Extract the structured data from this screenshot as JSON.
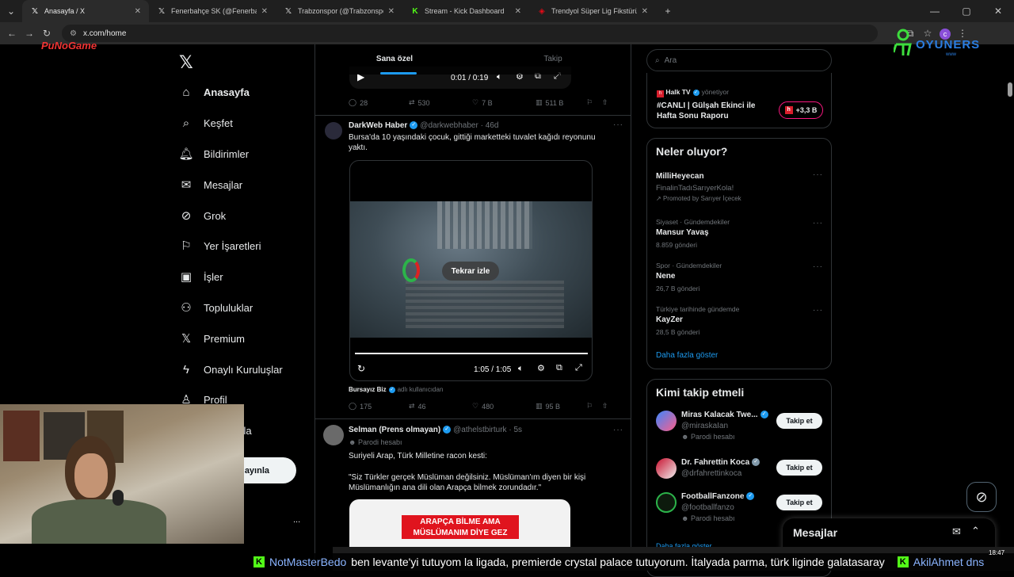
{
  "browser": {
    "tabs": [
      {
        "title": "Anasayfa / X",
        "icon": "x-logo-icon",
        "active": true
      },
      {
        "title": "Fenerbahçe SK (@Fenerbahce) ",
        "icon": "x-logo-icon"
      },
      {
        "title": "Trabzonspor (@Trabzonspor) / ",
        "icon": "x-logo-icon"
      },
      {
        "title": "Stream - Kick Dashboard",
        "icon": "kick-icon"
      },
      {
        "title": "Trendyol Süper Lig Fikstürü ve ",
        "icon": "tff-icon"
      }
    ],
    "address": "x.com/home"
  },
  "overlay": {
    "corner_logo": "PuNoGame",
    "brand_logo": "OYUNERS",
    "brand_sub": "www"
  },
  "nav": {
    "items": [
      {
        "label": "Anasayfa",
        "icon": "home-icon"
      },
      {
        "label": "Keşfet",
        "icon": "search-icon"
      },
      {
        "label": "Bildirimler",
        "icon": "bell-icon"
      },
      {
        "label": "Mesajlar",
        "icon": "mail-icon"
      },
      {
        "label": "Grok",
        "icon": "grok-icon"
      },
      {
        "label": "Yer İşaretleri",
        "icon": "bookmark-icon"
      },
      {
        "label": "İşler",
        "icon": "briefcase-icon"
      },
      {
        "label": "Topluluklar",
        "icon": "people-icon"
      },
      {
        "label": "Premium",
        "icon": "x-logo-icon"
      },
      {
        "label": "Onaylı Kuruluşlar",
        "icon": "lightning-icon"
      },
      {
        "label": "Profil",
        "icon": "person-icon"
      },
      {
        "label": "zla",
        "icon": ""
      }
    ],
    "post_button": "ayınla",
    "more": "..."
  },
  "feed": {
    "tabs": [
      "Sana özel",
      "Takip"
    ],
    "tweet0": {
      "video_time": "0:01 / 0:19",
      "replies": "28",
      "reposts": "530",
      "likes": "7 B",
      "views": "511 B"
    },
    "tweet1": {
      "name": "DarkWeb Haber",
      "handle": "@darkwebhaber · 46d",
      "text": "Bursa'da 10 yaşındaki çocuk, gittiği marketteki tuvalet kağıdı reyonunu yaktı.",
      "replay": "Tekrar izle",
      "video_time": "1:05 / 1:05",
      "credit_name": "Bursayız Biz",
      "credit_meta": "adlı kullanıcıdan",
      "replies": "175",
      "reposts": "46",
      "likes": "480",
      "views": "95 B"
    },
    "tweet2": {
      "name": "Selman (Prens olmayan)",
      "handle": "@athelstbirturk · 5s",
      "parody": "Parodi hesabı",
      "line1": "Suriyeli Arap, Türk Milletine racon kesti:",
      "line2": "\"Siz Türkler gerçek Müslüman değilsiniz. Müslüman'ım diyen bir kişi Müslümanlığın ana dili olan Arapça bilmek zorundadır.\"",
      "banner1": "ARAPÇA BİLME AMA",
      "banner2": "MÜSLÜMANIM DİYE GEZ"
    }
  },
  "right": {
    "search_placeholder": "Ara",
    "live": {
      "source": "Halk TV",
      "role": "yönetiyor",
      "title": "#CANLI | Gülşah Ekinci ile Hafta Sonu Raporu",
      "count": "+3,3 B"
    },
    "trends": {
      "title": "Neler oluyor?",
      "items": [
        {
          "meta": "",
          "name": "MilliHeyecan",
          "sub": "FinalinTadıSarıyerKola!",
          "promo": "Promoted by Sarıyer İçecek"
        },
        {
          "meta": "Siyaset · Gündemdekiler",
          "name": "Mansur Yavaş",
          "sub": "8.859 gönderi"
        },
        {
          "meta": "Spor · Gündemdekiler",
          "name": "Nene",
          "sub": "26,7 B gönderi"
        },
        {
          "meta": "Türkiye tarihinde gündemde",
          "name": "KayZer",
          "sub": "28,5 B gönderi"
        }
      ],
      "more": "Daha fazla göster"
    },
    "follow": {
      "title": "Kimi takip etmeli",
      "items": [
        {
          "name": "Miras Kalacak Twe...",
          "handle": "@miraskaIan",
          "sub": "Parodi hesabı"
        },
        {
          "name": "Dr. Fahrettin Koca",
          "handle": "@drfahrettinkoca",
          "sub": ""
        },
        {
          "name": "FootballFanzone",
          "handle": "@footballfanzo",
          "sub": "Parodi hesabı"
        }
      ],
      "button": "Takip et",
      "more": "Daha fazla göster"
    },
    "messages": "Mesajlar"
  },
  "ticker": {
    "user": "NotMasterBedo",
    "text": "ben levante'yi tutuyom la ligada, premierde crystal palace tutuyorum. İtalyada parma, türk liginde galatasaray",
    "trail": "AkilAhmet dns"
  },
  "taskbar": {
    "time": "18:47"
  }
}
